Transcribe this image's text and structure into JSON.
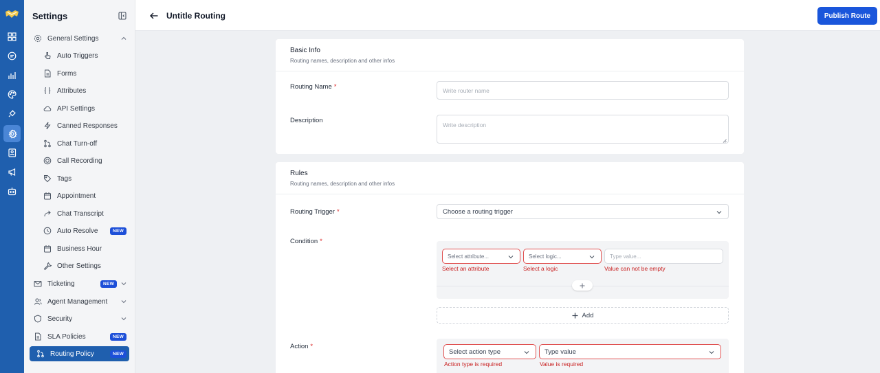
{
  "colors": {
    "rail": "#1f5fae",
    "primary": "#1a56db",
    "badge": "#1d4fd8",
    "error": "#c81e1e"
  },
  "sidebar": {
    "title": "Settings",
    "groups": [
      {
        "label": "General Settings",
        "icon": "gear-icon"
      },
      {
        "label": "Ticketing",
        "badge": "NEW",
        "icon": "mail-icon"
      },
      {
        "label": "Agent Management",
        "icon": "user-group-icon"
      },
      {
        "label": "Security",
        "icon": "shield-icon"
      },
      {
        "label": "SLA Policies",
        "badge": "NEW",
        "icon": "document-icon"
      },
      {
        "label": "Routing Policy",
        "badge": "NEW",
        "icon": "route-icon"
      }
    ],
    "items": [
      {
        "label": "Auto Triggers"
      },
      {
        "label": "Forms"
      },
      {
        "label": "Attributes"
      },
      {
        "label": "API Settings"
      },
      {
        "label": "Canned Responses"
      },
      {
        "label": "Chat Turn-off"
      },
      {
        "label": "Call Recording"
      },
      {
        "label": "Tags"
      },
      {
        "label": "Appointment"
      },
      {
        "label": "Chat Transcript"
      },
      {
        "label": "Auto Resolve",
        "badge": "NEW"
      },
      {
        "label": "Business Hour"
      },
      {
        "label": "Other Settings"
      }
    ]
  },
  "header": {
    "title": "Untitle Routing",
    "publish_label": "Publish Route"
  },
  "basic_info": {
    "title": "Basic Info",
    "subtitle": "Routing names, description and other infos",
    "name_label": "Routing Name",
    "name_placeholder": "Write router name",
    "desc_label": "Description",
    "desc_placeholder": "Write description"
  },
  "rules": {
    "title": "Rules",
    "subtitle": "Routing names, description and other infos",
    "trigger_label": "Routing Trigger",
    "trigger_value": "Choose a routing trigger",
    "condition_label": "Condition",
    "attr_placeholder": "Select attribute...",
    "logic_placeholder": "Select logic...",
    "value_placeholder": "Type value...",
    "attr_error": "Select an attribute",
    "logic_error": "Select a logic",
    "value_error": "Value can not be empty",
    "add_label": "Add",
    "action_label": "Action",
    "action_type_placeholder": "Select action type",
    "action_value_placeholder": "Type value",
    "action_type_error": "Action type is required",
    "action_value_error": "Value is required"
  },
  "required_mark": "*"
}
